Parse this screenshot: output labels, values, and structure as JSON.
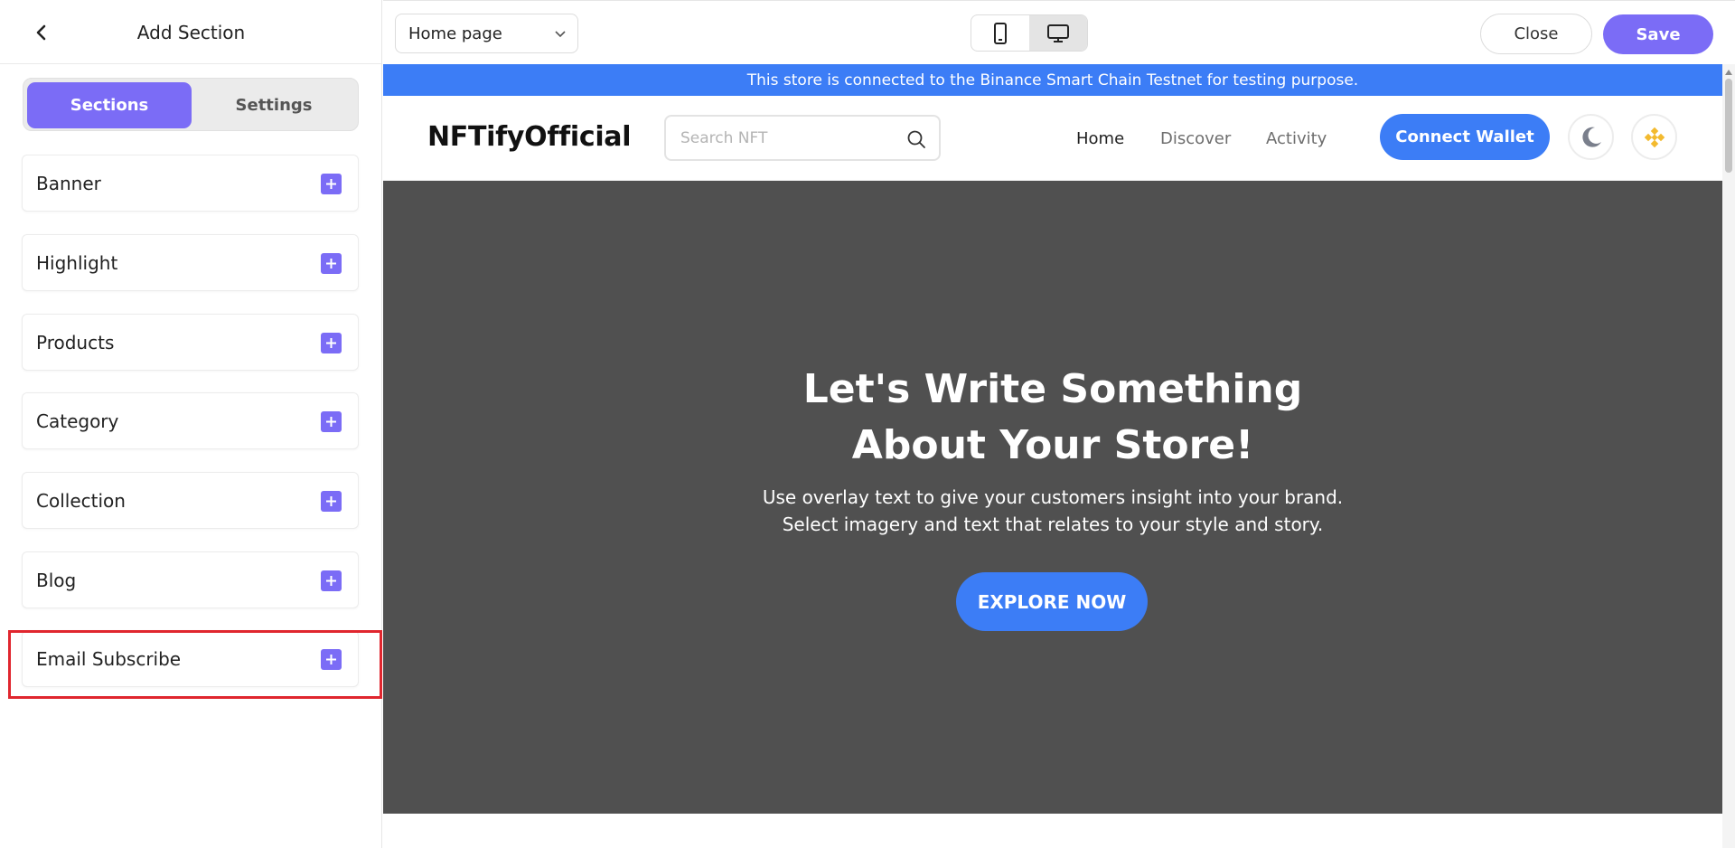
{
  "panel": {
    "title": "Add Section",
    "tabs": [
      {
        "label": "Sections",
        "active": true
      },
      {
        "label": "Settings",
        "active": false
      }
    ],
    "items": [
      {
        "label": "Banner"
      },
      {
        "label": "Highlight"
      },
      {
        "label": "Products"
      },
      {
        "label": "Category"
      },
      {
        "label": "Collection"
      },
      {
        "label": "Blog"
      },
      {
        "label": "Email Subscribe"
      }
    ],
    "highlighted_item": "Email Subscribe"
  },
  "toolbar": {
    "page_select": "Home page",
    "device_icons": [
      "mobile-icon",
      "desktop-icon"
    ],
    "active_device": "desktop",
    "close_label": "Close",
    "save_label": "Save"
  },
  "store": {
    "notice": "This store is connected to the Binance Smart Chain Testnet for testing purpose.",
    "logo": "NFTifyOfficial",
    "search_placeholder": "Search NFT",
    "nav": [
      "Home",
      "Discover",
      "Activity"
    ],
    "connect_label": "Connect Wallet",
    "hero": {
      "title_line1": "Let's Write Something",
      "title_line2": "About Your Store!",
      "sub_line1": "Use overlay text to give your customers insight into your brand.",
      "sub_line2": "Select imagery and text that relates to your style and story.",
      "button": "EXPLORE NOW"
    }
  },
  "colors": {
    "accent": "#7b6cf6",
    "store_blue": "#3c7df6",
    "hero_bg": "#505050",
    "highlight": "#e0262e",
    "bnb_gold": "#f3ba2f"
  }
}
